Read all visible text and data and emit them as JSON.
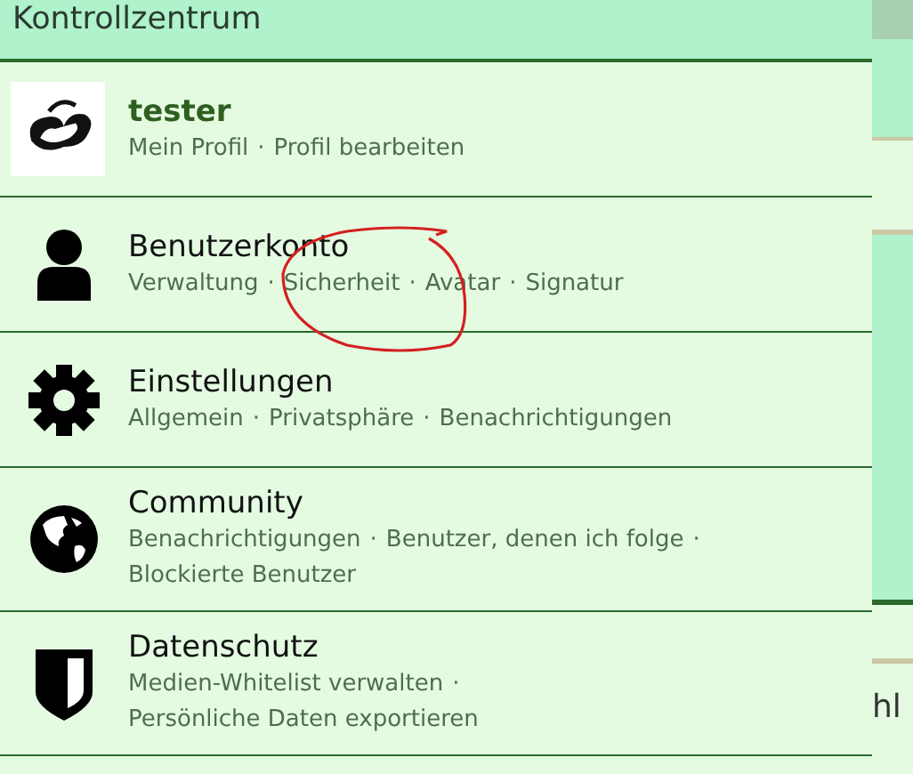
{
  "panel": {
    "title": "Kontrollzentrum",
    "separator": "·"
  },
  "rows": [
    {
      "kind": "profile",
      "title": "tester",
      "lines": [
        [
          "Mein Profil",
          "Profil bearbeiten"
        ]
      ]
    },
    {
      "kind": "account",
      "title": "Benutzerkonto",
      "lines": [
        [
          "Verwaltung",
          "Sicherheit",
          "Avatar",
          "Signatur"
        ]
      ]
    },
    {
      "kind": "settings",
      "title": "Einstellungen",
      "lines": [
        [
          "Allgemein",
          "Privatsphäre",
          "Benachrichtigungen"
        ]
      ]
    },
    {
      "kind": "community",
      "title": "Community",
      "lines": [
        [
          "Benachrichtigungen",
          "Benutzer, denen ich folge"
        ],
        [
          "Blockierte Benutzer"
        ]
      ]
    },
    {
      "kind": "privacy",
      "title": "Datenschutz",
      "lines": [
        [
          "Medien-Whitelist verwalten"
        ],
        [
          "Persönliche Daten exportieren"
        ]
      ]
    }
  ],
  "background": {
    "text": "hl"
  }
}
